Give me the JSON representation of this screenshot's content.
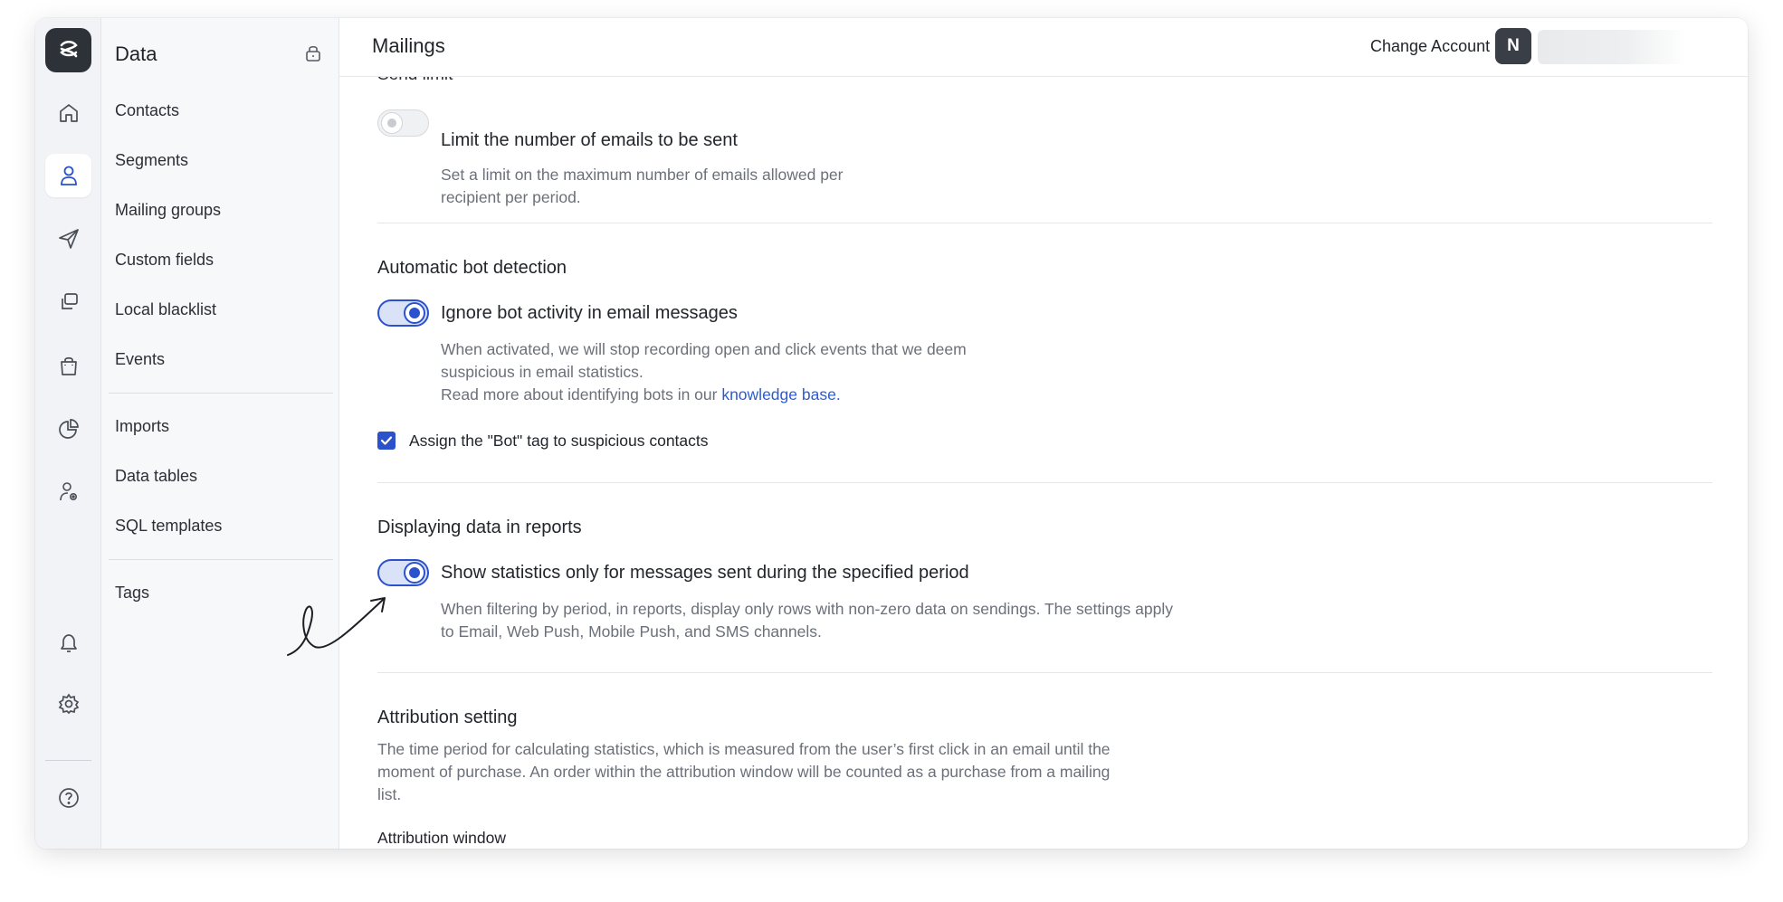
{
  "rail": {
    "icons": [
      "logo-icon",
      "home-icon",
      "contacts-icon",
      "send-icon",
      "templates-icon",
      "shop-icon",
      "reports-icon",
      "user-settings-icon",
      "bell-icon",
      "gear-icon",
      "help-icon"
    ],
    "active": "contacts-icon"
  },
  "sidebar": {
    "title": "Data",
    "items_group1": [
      "Contacts",
      "Segments",
      "Mailing groups",
      "Custom fields",
      "Local blacklist",
      "Events"
    ],
    "items_group2": [
      "Imports",
      "Data tables",
      "SQL templates"
    ],
    "items_group3": [
      "Tags"
    ]
  },
  "header": {
    "title": "Mailings",
    "change_account": "Change Account",
    "avatar_initial": "N"
  },
  "content": {
    "cut_heading": "Send limit",
    "send_limit": {
      "toggle_label": "Limit the number of emails to be sent",
      "toggle_on": false,
      "desc_line1": "Set a limit on the maximum number of emails allowed per",
      "desc_line2": "recipient per period."
    },
    "bot_detection": {
      "title": "Automatic bot detection",
      "toggle_label": "Ignore bot activity in email messages",
      "toggle_on": true,
      "desc_line1": "When activated, we will stop recording open and click events that we deem",
      "desc_line2": "suspicious in email statistics.",
      "desc_line3_prefix": "Read more about identifying bots in our ",
      "desc_link": "knowledge base",
      "desc_line3_suffix": ".",
      "checkbox_label": "Assign the \"Bot\" tag to suspicious contacts",
      "checkbox_checked": true
    },
    "reports": {
      "title": "Displaying data in reports",
      "toggle_label": "Show statistics only for messages sent during the specified period",
      "toggle_on": true,
      "desc_line1": "When filtering by period, in reports, display only rows with non-zero data on sendings. The settings apply",
      "desc_line2": "to Email, Web Push, Mobile Push, and SMS channels."
    },
    "attribution": {
      "title": "Attribution setting",
      "desc_line1": "The time period for calculating statistics, which is measured from the user’s first click in an email until the",
      "desc_line2": "moment of purchase. An order within the attribution window will be counted as a purchase from a mailing",
      "desc_line3": "list.",
      "window_label": "Attribution window"
    }
  },
  "colors": {
    "accent": "#2b52cc",
    "link": "#2a5bd7"
  }
}
